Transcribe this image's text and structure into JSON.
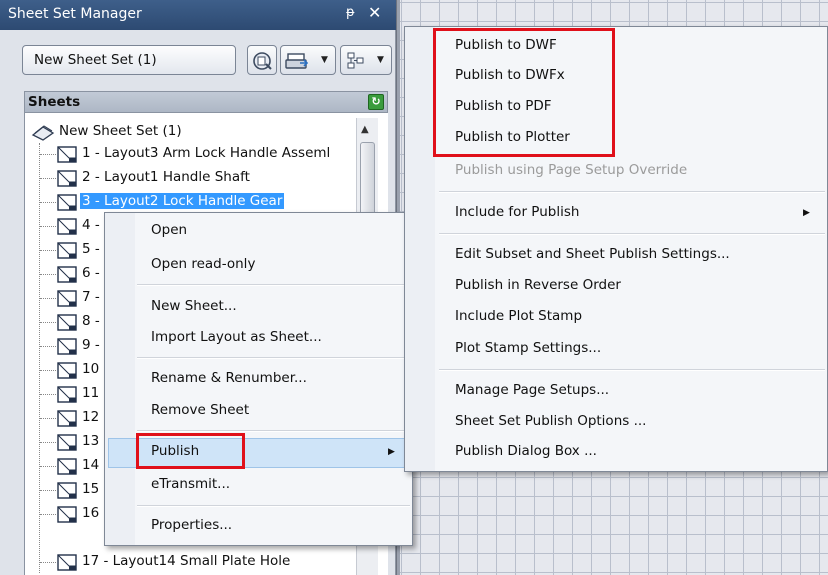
{
  "palette": {
    "title": "Sheet Set Manager",
    "pin_glyph": "ᵽ",
    "close_glyph": "✕",
    "sheet_set_select": {
      "value": "New Sheet Set (1)"
    },
    "toolbar_icons": [
      "sheet-set-details-icon",
      "publish-icon",
      "sheet-view-icon"
    ],
    "sheets_header": "Sheets",
    "tree": {
      "root": "New Sheet Set (1)",
      "sheets": [
        "1 - Layout3 Arm Lock Handle Asseml",
        "2 - Layout1 Handle Shaft",
        "3 - Layout2 Lock Handle Gear",
        "4 -",
        "5 -",
        "6 -",
        "7 -",
        "8 -",
        "9 -",
        "10",
        "11",
        "12",
        "13",
        "14",
        "15",
        "16",
        "17 - Layout14 Small Plate Hole"
      ],
      "selected_index": 2
    }
  },
  "context_menu": {
    "items": [
      "Open",
      "Open read-only",
      "New Sheet...",
      "Import Layout as Sheet...",
      "Rename & Renumber...",
      "Remove Sheet",
      "Publish",
      "eTransmit...",
      "Properties..."
    ],
    "highlighted": "Publish"
  },
  "publish_menu": {
    "items": [
      "Publish to DWF",
      "Publish to DWFx",
      "Publish to PDF",
      "Publish to Plotter",
      "Publish using Page Setup Override",
      "Include for Publish",
      "Edit Subset and Sheet Publish Settings...",
      "Publish in Reverse Order",
      "Include Plot Stamp",
      "Plot Stamp Settings...",
      "Manage Page Setups...",
      "Sheet Set Publish Options ...",
      "Publish Dialog Box ..."
    ],
    "disabled": [
      "Publish using Page Setup Override"
    ]
  },
  "colors": {
    "title_bar": "#34527c",
    "selection": "#3399ff",
    "highlight_box": "#e0101a"
  }
}
